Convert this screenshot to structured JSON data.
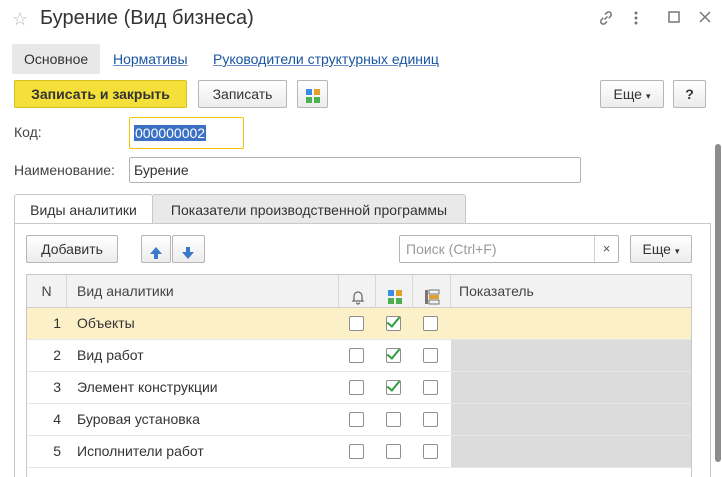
{
  "window": {
    "title": "Бурение (Вид бизнеса)",
    "icons": [
      "star-icon",
      "link-icon",
      "more-vertical-icon",
      "maximize-icon",
      "close-icon"
    ]
  },
  "nav": {
    "tabs": [
      {
        "label": "Основное",
        "active": true
      },
      {
        "label": "Нормативы",
        "active": false
      },
      {
        "label": "Руководители структурных единиц",
        "active": false
      }
    ]
  },
  "toolbar": {
    "save_close_label": "Записать и закрыть",
    "save_label": "Записать",
    "more_label": "Еще",
    "help_label": "?"
  },
  "form": {
    "code_label": "Код:",
    "code_value": "000000002",
    "name_label": "Наименование:",
    "name_value": "Бурение"
  },
  "form_tabs": [
    {
      "label": "Виды аналитики",
      "active": true
    },
    {
      "label": "Показатели производственной программы",
      "active": false
    }
  ],
  "table_toolbar": {
    "add_label": "Добавить",
    "search_placeholder": "Поиск (Ctrl+F)",
    "clear_label": "×",
    "more_label": "Еще"
  },
  "table": {
    "columns": [
      "N",
      "Вид аналитики",
      "",
      "",
      "",
      "Показатель"
    ],
    "rows": [
      {
        "n": "1",
        "name": "Объекты",
        "c1": false,
        "c2": true,
        "c3": false,
        "indicator": ""
      },
      {
        "n": "2",
        "name": "Вид работ",
        "c1": false,
        "c2": true,
        "c3": false,
        "indicator": ""
      },
      {
        "n": "3",
        "name": "Элемент конструкции",
        "c1": false,
        "c2": true,
        "c3": false,
        "indicator": ""
      },
      {
        "n": "4",
        "name": "Буровая установка",
        "c1": false,
        "c2": false,
        "c3": false,
        "indicator": ""
      },
      {
        "n": "5",
        "name": "Исполнители работ",
        "c1": false,
        "c2": false,
        "c3": false,
        "indicator": ""
      }
    ],
    "selected_row": 0
  },
  "colors": {
    "primary_button": "#f5e03a",
    "link": "#1a55a0",
    "selection": "#3b70c4",
    "selected_row": "#fbf0c8",
    "check": "#2f9d3a"
  }
}
